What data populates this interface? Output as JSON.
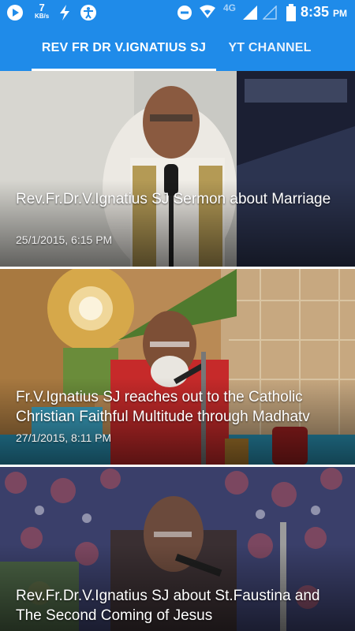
{
  "status_bar": {
    "speed_value": "7",
    "speed_unit": "KB/s",
    "network": "4G",
    "time": "8:35",
    "ampm": "PM"
  },
  "tabs": [
    {
      "label": "REV FR DR V.IGNATIUS SJ",
      "selected": true
    },
    {
      "label": "YT CHANNEL",
      "selected": false
    }
  ],
  "videos": [
    {
      "title": "Rev.Fr.Dr.V.Ignatius SJ  Sermon about Marriage",
      "date": "25/1/2015, 6:15 PM"
    },
    {
      "title": "Fr.V.Ignatius SJ reaches out to the Catholic Christian Faithful Multitude through Madhatv",
      "date": "27/1/2015, 8:11 PM"
    },
    {
      "title": "Rev.Fr.Dr.V.Ignatius SJ about St.Faustina and The Second Coming of Jesus",
      "date": ""
    }
  ],
  "colors": {
    "primary": "#1f8be9",
    "indicator": "#ffffff"
  }
}
